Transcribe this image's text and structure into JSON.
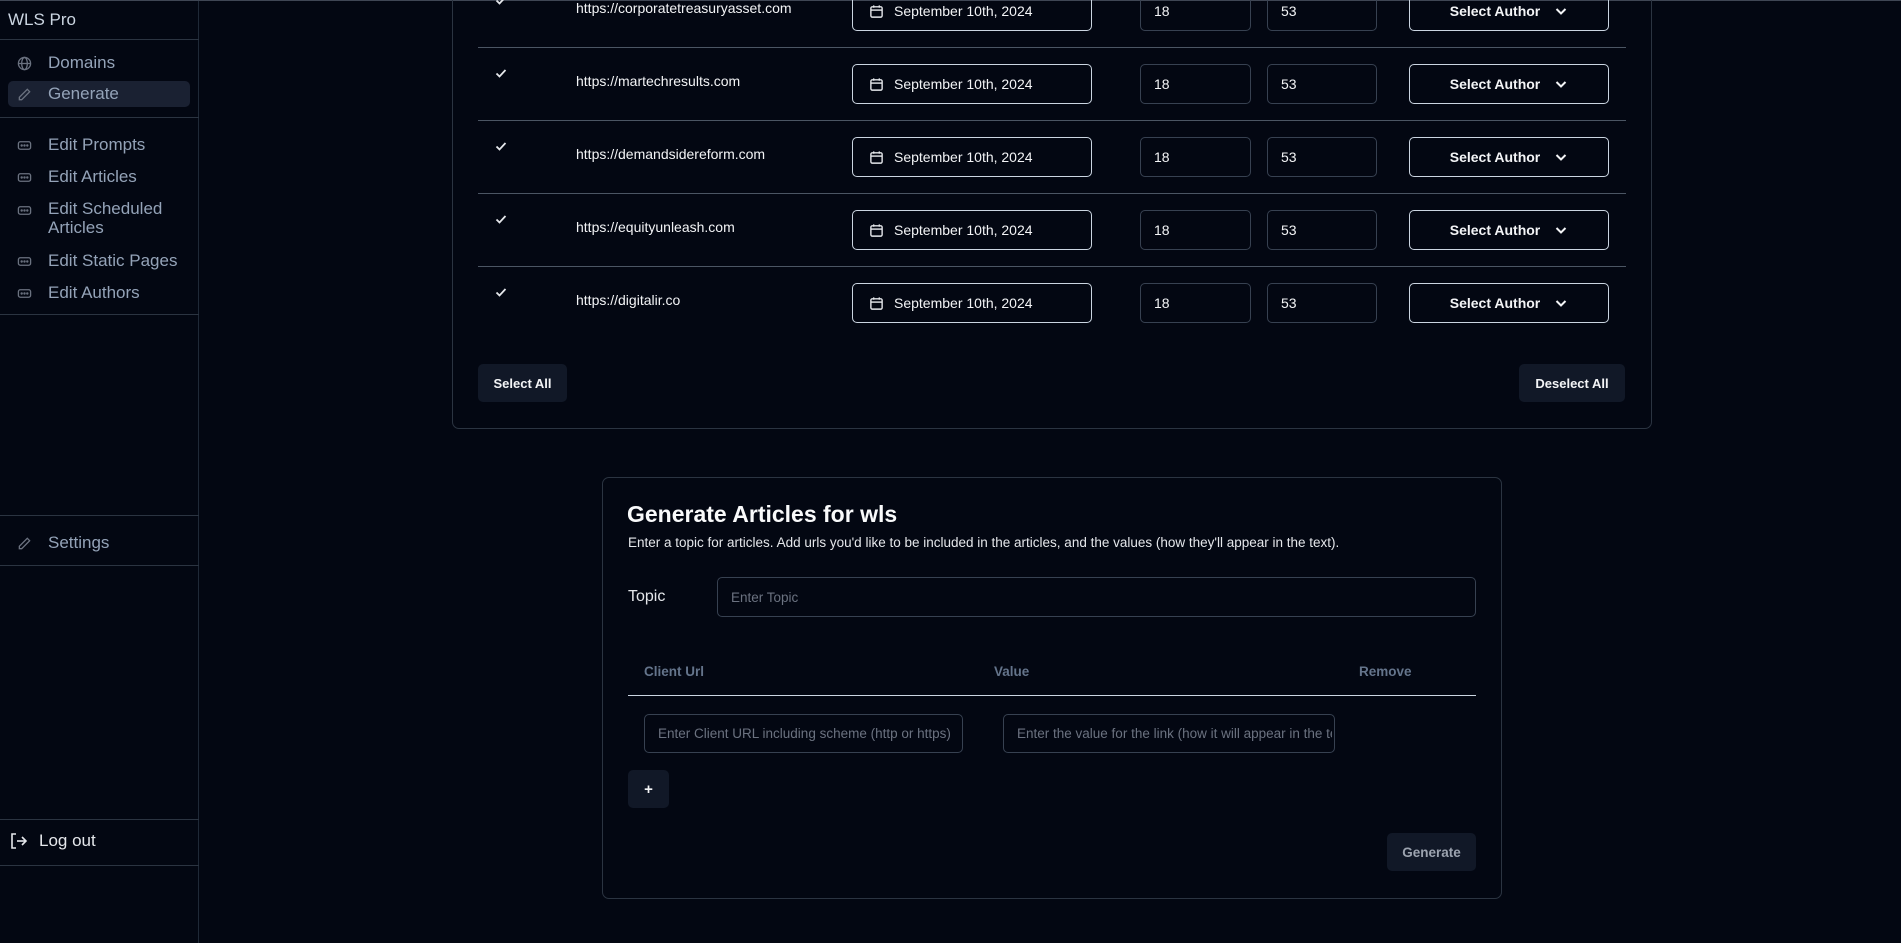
{
  "sidebar": {
    "app_title": "WLS Pro",
    "items": [
      {
        "label": "Domains",
        "icon": "globe-icon"
      },
      {
        "label": "Generate",
        "icon": "pencil-icon"
      },
      {
        "label": "Edit Prompts",
        "icon": "dots-icon"
      },
      {
        "label": "Edit Articles",
        "icon": "dots-icon"
      },
      {
        "label": "Edit Scheduled Articles",
        "icon": "dots-icon"
      },
      {
        "label": "Edit Static Pages",
        "icon": "dots-icon"
      },
      {
        "label": "Edit Authors",
        "icon": "dots-icon"
      },
      {
        "label": "Settings",
        "icon": "pencil-icon"
      }
    ],
    "logout_label": "Log out"
  },
  "schedule_table": {
    "rows": [
      {
        "url": "https://corporatetreasuryasset.com",
        "date": "September 10th, 2024",
        "hour": "18",
        "minute": "53",
        "author": "Select Author",
        "checked": true
      },
      {
        "url": "https://martechresults.com",
        "date": "September 10th, 2024",
        "hour": "18",
        "minute": "53",
        "author": "Select Author",
        "checked": true
      },
      {
        "url": "https://demandsidereform.com",
        "date": "September 10th, 2024",
        "hour": "18",
        "minute": "53",
        "author": "Select Author",
        "checked": true
      },
      {
        "url": "https://equityunleash.com",
        "date": "September 10th, 2024",
        "hour": "18",
        "minute": "53",
        "author": "Select Author",
        "checked": true
      },
      {
        "url": "https://digitalir.co",
        "date": "September 10th, 2024",
        "hour": "18",
        "minute": "53",
        "author": "Select Author",
        "checked": true
      }
    ],
    "select_all_label": "Select All",
    "deselect_all_label": "Deselect All"
  },
  "generate": {
    "title": "Generate Articles for wls",
    "description": "Enter a topic for articles. Add urls you'd like to be included in the articles, and the values (how they'll appear in the text).",
    "topic_label": "Topic",
    "topic_placeholder": "Enter Topic",
    "columns": {
      "client_url": "Client Url",
      "value": "Value",
      "remove": "Remove"
    },
    "client_url_placeholder": "Enter Client URL including scheme (http or https)",
    "value_placeholder": "Enter the value for the link (how it will appear in the text)",
    "add_label": "+",
    "generate_label": "Generate"
  },
  "colors": {
    "background": "#030712",
    "surface_button": "#111827",
    "border": "#374151",
    "muted_text": "#64748b"
  }
}
